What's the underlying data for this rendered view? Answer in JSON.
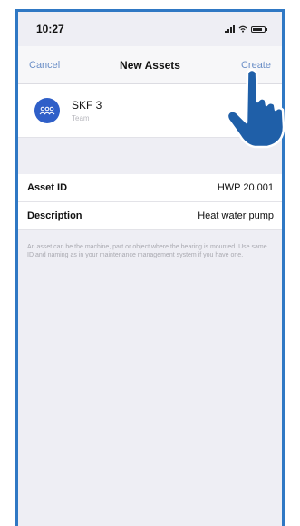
{
  "status_bar": {
    "time": "10:27",
    "icons": [
      "signal-icon",
      "wifi-icon",
      "battery-icon"
    ]
  },
  "nav": {
    "cancel_label": "Cancel",
    "title": "New Assets",
    "create_label": "Create"
  },
  "team": {
    "name": "SKF 3",
    "subtitle": "Team",
    "avatar_icon": "team-icon",
    "avatar_color": "#2f5fc8"
  },
  "form": {
    "fields": [
      {
        "label": "Asset ID",
        "value": "HWP 20.001"
      },
      {
        "label": "Description",
        "value": "Heat water pump"
      }
    ]
  },
  "help_text": "An asset can be the machine, part or object where the bearing is mounted. Use same ID and naming as in your maintenance management system if you have one.",
  "colors": {
    "accent": "#6b8fc7",
    "frame_border": "#2f78c4",
    "pointer_hand": "#1f5fa8",
    "background": "#eeeef4"
  },
  "overlay": {
    "pointer_icon": "pointing-hand-icon"
  }
}
